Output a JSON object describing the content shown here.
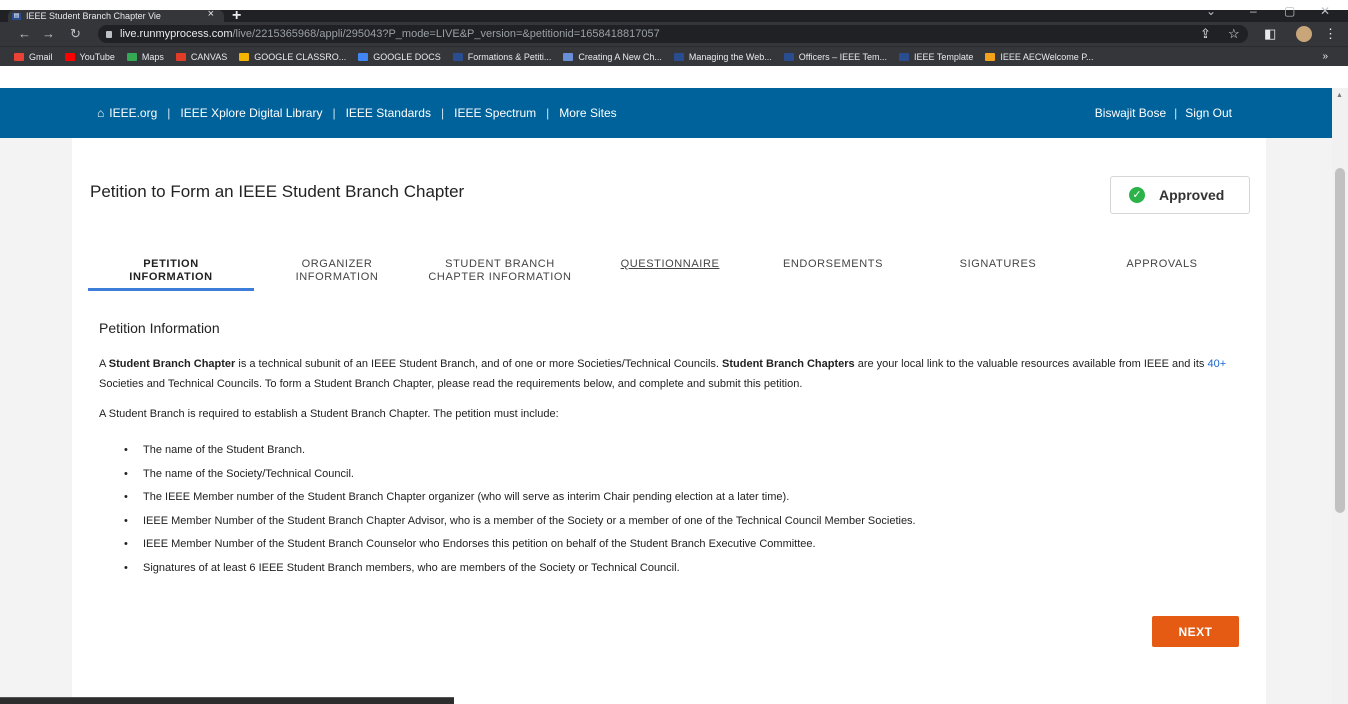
{
  "browser": {
    "tab_title": "IEEE Student Branch Chapter Vie",
    "url_host": "live.runmyprocess.com",
    "url_path": "/live/2215365968/appli/295043?P_mode=LIVE&P_version=&petitionid=1658418817057",
    "bookmarks": [
      {
        "label": "Gmail",
        "color": "#ea4335"
      },
      {
        "label": "YouTube",
        "color": "#ff0000"
      },
      {
        "label": "Maps",
        "color": "#34a853"
      },
      {
        "label": "CANVAS",
        "color": "#e13c28"
      },
      {
        "label": "GOOGLE CLASSRO...",
        "color": "#f4b400"
      },
      {
        "label": "GOOGLE DOCS",
        "color": "#4285f4"
      },
      {
        "label": "Formations & Petiti...",
        "color": "#2a4d8f"
      },
      {
        "label": "Creating A New Ch...",
        "color": "#6b8fd6"
      },
      {
        "label": "Managing the Web...",
        "color": "#2a4d8f"
      },
      {
        "label": "Officers – IEEE Tem...",
        "color": "#2a4d8f"
      },
      {
        "label": "IEEE Template",
        "color": "#2a4d8f"
      },
      {
        "label": "IEEE AECWelcome P...",
        "color": "#f4a21c"
      }
    ]
  },
  "header": {
    "links": [
      "IEEE.org",
      "IEEE Xplore Digital Library",
      "IEEE Standards",
      "IEEE Spectrum",
      "More Sites"
    ],
    "user": "Biswajit Bose",
    "signout": "Sign Out"
  },
  "page": {
    "title": "Petition to Form an IEEE Student Branch Chapter",
    "status": "Approved",
    "tabs": [
      {
        "line1": "PETITION",
        "line2": "INFORMATION"
      },
      {
        "line1": "ORGANIZER",
        "line2": "INFORMATION"
      },
      {
        "line1": "STUDENT BRANCH",
        "line2": "CHAPTER INFORMATION"
      },
      {
        "line1": "QUESTIONNAIRE",
        "line2": ""
      },
      {
        "line1": "ENDORSEMENTS",
        "line2": ""
      },
      {
        "line1": "SIGNATURES",
        "line2": ""
      },
      {
        "line1": "APPROVALS",
        "line2": ""
      }
    ],
    "section_title": "Petition Information",
    "intro": {
      "p1": "A ",
      "b1": "Student Branch Chapter",
      "p2": " is a technical subunit of an IEEE Student Branch, and of one or more Societies/Technical Councils. ",
      "b2": "Student Branch Chapters",
      "p3": " are your local link to the valuable resources available from IEEE and its ",
      "link": "40+",
      "p4": " Societies and Technical Councils. To form a Student Branch Chapter, please read the requirements below, and complete and submit this petition."
    },
    "requirements_intro": "A Student Branch is required to establish a Student Branch Chapter. The petition must include:",
    "requirements": [
      "The name of the Student Branch.",
      "The name of the Society/Technical Council.",
      "The IEEE Member number of the Student Branch Chapter organizer (who will serve as interim Chair pending election at a later time).",
      "IEEE Member Number of the Student Branch Chapter Advisor, who is a member of the Society or a member of one of the Technical Council Member Societies.",
      "IEEE Member Number of the Student Branch Counselor who Endorses this petition on behalf of the Student Branch Executive Committee.",
      "Signatures of at least 6 IEEE Student Branch members, who are members of the Society or Technical Council."
    ],
    "next_label": "NEXT"
  }
}
